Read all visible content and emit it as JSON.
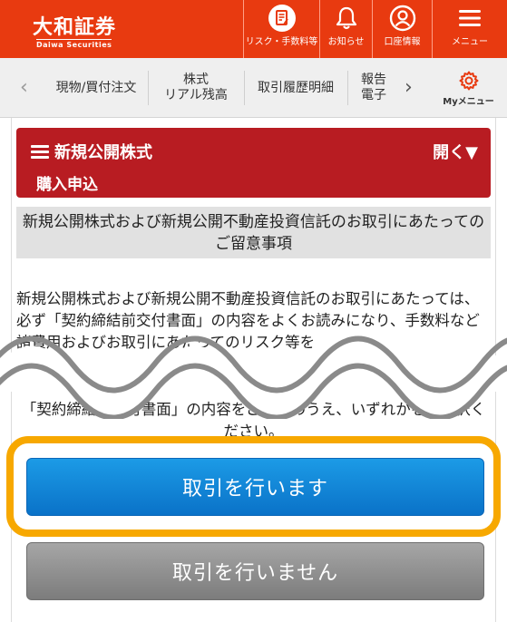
{
  "header": {
    "logo_jp": "大和証券",
    "logo_en": "Daiwa Securities",
    "buttons": [
      {
        "label": "リスク・手数料等",
        "icon": "document-pen-icon"
      },
      {
        "label": "お知らせ",
        "icon": "bell-icon"
      },
      {
        "label": "口座情報",
        "icon": "user-icon"
      },
      {
        "label": "メニュー",
        "icon": "hamburger-menu-icon"
      }
    ]
  },
  "nav": {
    "items": [
      {
        "label": "現物/買付注文"
      },
      {
        "label": "株式\nリアル残高"
      },
      {
        "label": "取引履歴明細"
      },
      {
        "label": "報告\n電子"
      }
    ],
    "my_menu_label": "Myメニュー",
    "my_menu_icon": "gear-icon"
  },
  "section": {
    "title": "新規公開株式",
    "toggle_label": "開く▼",
    "subtitle": "購入申込"
  },
  "notice": {
    "heading": "新規公開株式および新規公開不動産投資信託のお取引にあたってのご留意事項"
  },
  "body": {
    "paragraph_1": "新規公開株式および新規公開不動産投資信託のお取引にあたっては、必ず「契約締結前交付書面」の内容をよくお読みになり、手数料など諸費用およびお取引にあたってのリスク等を",
    "paragraph_2": "「契約締結前交付書面」の内容をご確認のうえ、いずれかをご選択ください。"
  },
  "actions": {
    "proceed_label": "取引を行います",
    "decline_label": "取引を行いません"
  },
  "colors": {
    "header_bg": "#e83a10",
    "section_bg": "#b81c22",
    "highlight": "#f7a800",
    "primary_button": "#1786d9",
    "secondary_button": "#8f8f8f"
  }
}
